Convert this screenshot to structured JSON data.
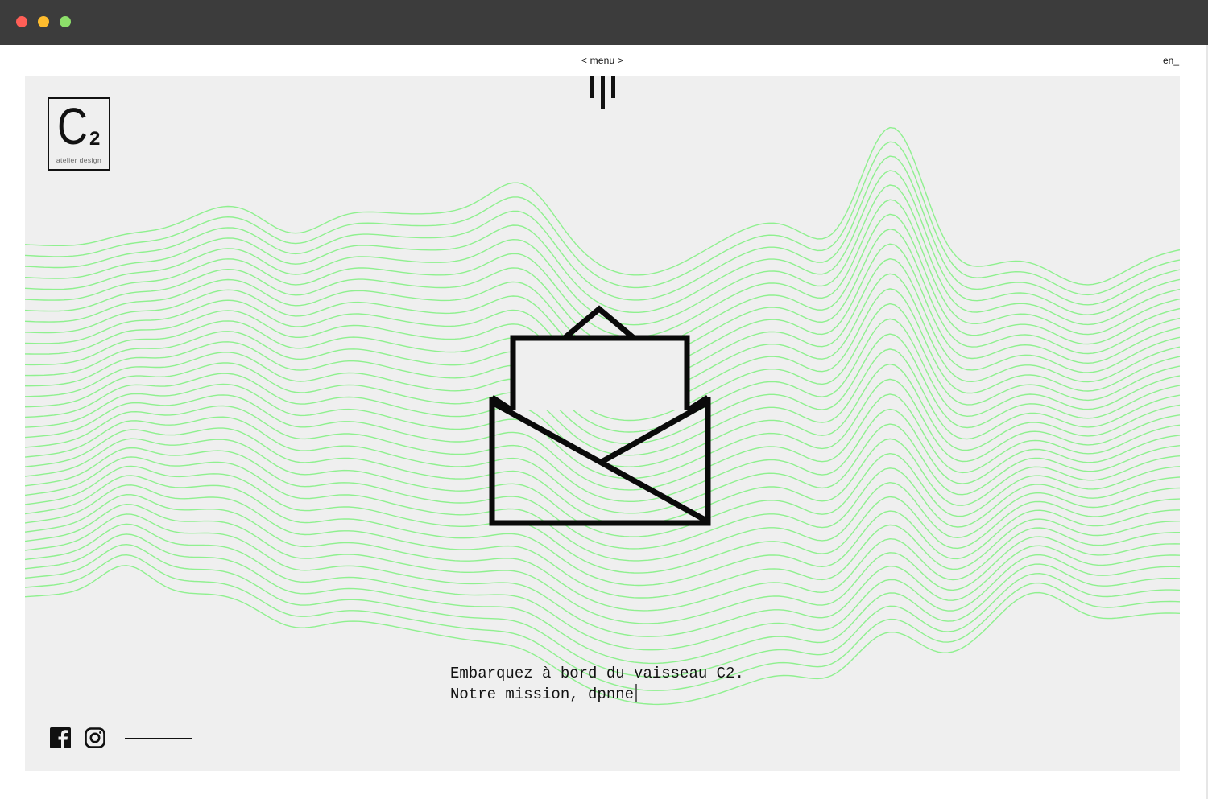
{
  "window": {
    "controls": [
      "close",
      "minimize",
      "zoom"
    ],
    "colors": {
      "close": "#ff5f57",
      "minimize": "#febc2e",
      "zoom": "#8ddf6a"
    }
  },
  "header": {
    "menu_label": "< menu >",
    "language_label": "en_",
    "menu_icon": "bars-icon"
  },
  "logo": {
    "letter": "C",
    "number": "2",
    "subtitle": "atelier design"
  },
  "hero": {
    "icon": "open-envelope-icon",
    "wave_color": "#7ef07e",
    "tagline_line1": "Embarquez à bord du vaisseau C2.",
    "tagline_line2": "Notre mission, dpnne"
  },
  "footer": {
    "social": [
      "facebook-icon",
      "instagram-icon"
    ]
  },
  "colors": {
    "panel_bg": "#efefef",
    "ink": "#111111",
    "accent_green": "#7ef07e"
  }
}
